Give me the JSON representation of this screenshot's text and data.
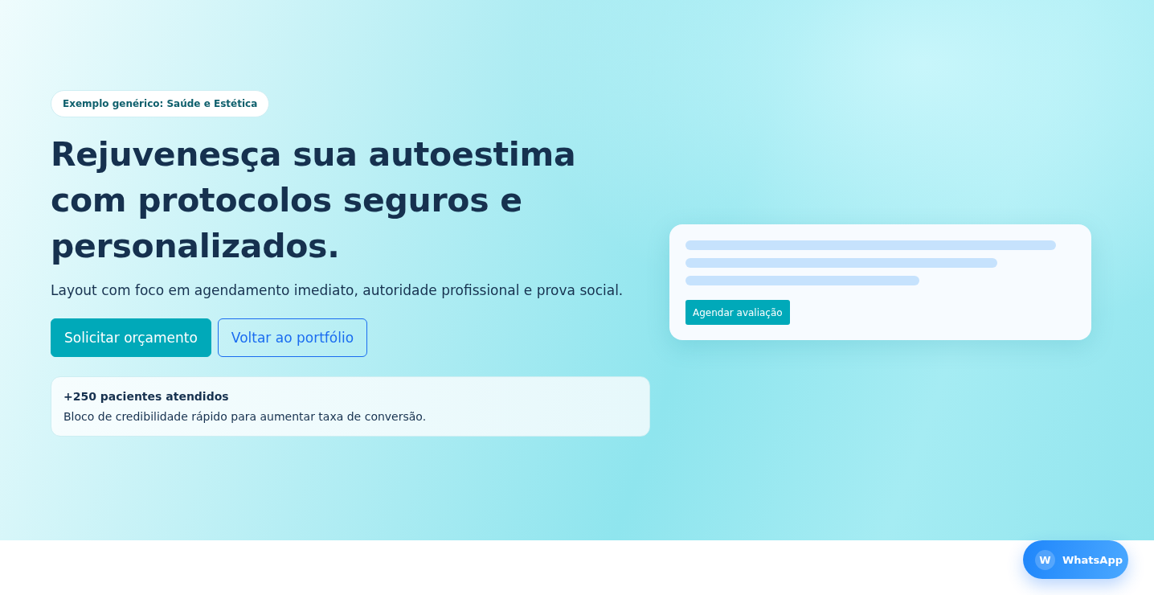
{
  "hero": {
    "badge": "Exemplo genérico: Saúde e Estética",
    "title": "Rejuvenesça sua autoestima com protocolos seguros e personalizados.",
    "subtitle": "Layout com foco em agendamento imediato, autoridade profissional e prova social.",
    "buttons": [
      {
        "label": "Solicitar orçamento",
        "kind": "primary"
      },
      {
        "label": "Voltar ao portfólio",
        "kind": "outline"
      }
    ],
    "proof": {
      "title": "+250 pacientes atendidos",
      "text": "Bloco de credibilidade rápido para aumentar taxa de conversão."
    },
    "preview_card": {
      "button": "Agendar avaliação"
    }
  },
  "whatsapp": {
    "icon_letter": "W",
    "label": "WhatsApp"
  }
}
